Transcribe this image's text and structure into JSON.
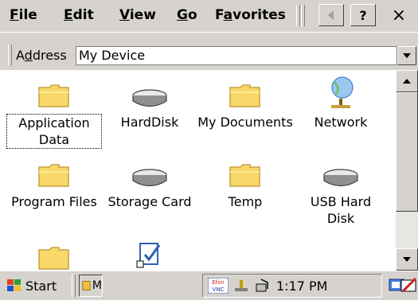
{
  "menu": {
    "file": {
      "pre": "",
      "u": "F",
      "post": "ile"
    },
    "edit": {
      "pre": "",
      "u": "E",
      "post": "dit"
    },
    "view": {
      "pre": "",
      "u": "V",
      "post": "iew"
    },
    "go": {
      "pre": "",
      "u": "G",
      "post": "o"
    },
    "favorites": {
      "pre": "F",
      "u": "a",
      "post": "vorites"
    }
  },
  "toolbar": {
    "help_label": "?",
    "close_label": "×"
  },
  "address": {
    "label_pre": "A",
    "label_u": "d",
    "label_post": "dress",
    "value": "My Device"
  },
  "items": [
    {
      "label": "Application Data",
      "icon": "folder-icon",
      "selected": true
    },
    {
      "label": "HardDisk",
      "icon": "drive-icon"
    },
    {
      "label": "My Documents",
      "icon": "folder-icon"
    },
    {
      "label": "Network",
      "icon": "network-icon"
    },
    {
      "label": "Program Files",
      "icon": "folder-icon"
    },
    {
      "label": "Storage Card",
      "icon": "drive-icon"
    },
    {
      "label": "Temp",
      "icon": "folder-icon"
    },
    {
      "label": "USB Hard Disk",
      "icon": "drive-icon"
    }
  ],
  "taskbar": {
    "start_label": "Start",
    "task_label": "M",
    "clock": "1:17 PM",
    "vnc_top": "Efon",
    "vnc_bottom": "VNC"
  },
  "colors": {
    "folder": "#f8d868",
    "folder_edge": "#c8a040",
    "chrome": "#d6d3ce"
  }
}
